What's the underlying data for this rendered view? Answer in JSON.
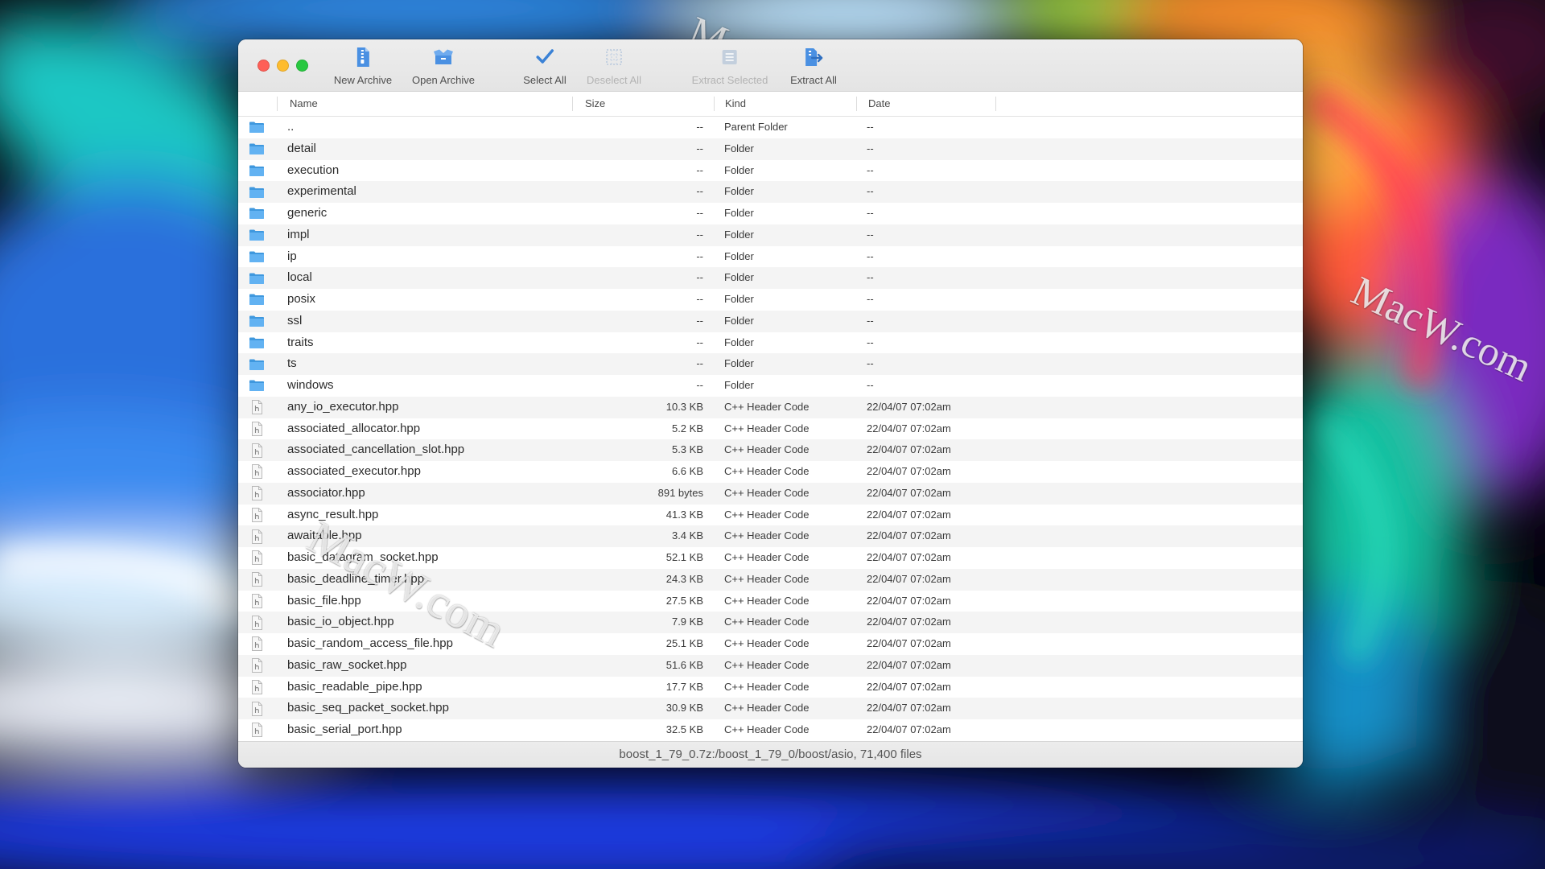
{
  "colors": {
    "accent": "#4a90e2",
    "traffic_close": "#fe5f57",
    "traffic_minimize": "#febc2e",
    "traffic_zoom": "#28c840"
  },
  "toolbar": [
    {
      "label": "New Archive",
      "icon": "new-archive-icon",
      "enabled": true
    },
    {
      "label": "Open Archive",
      "icon": "open-archive-icon",
      "enabled": true
    },
    {
      "label": "Select All",
      "icon": "select-all-icon",
      "enabled": true
    },
    {
      "label": "Deselect All",
      "icon": "deselect-all-icon",
      "enabled": false
    },
    {
      "label": "Extract Selected",
      "icon": "extract-selected-icon",
      "enabled": false
    },
    {
      "label": "Extract All",
      "icon": "extract-all-icon",
      "enabled": true
    }
  ],
  "columns": {
    "name": "Name",
    "size": "Size",
    "kind": "Kind",
    "date": "Date"
  },
  "rows": [
    {
      "name": "..",
      "size": "--",
      "kind": "Parent Folder",
      "date": "--",
      "icon": "folder-icon"
    },
    {
      "name": "detail",
      "size": "--",
      "kind": "Folder",
      "date": "--",
      "icon": "folder-icon"
    },
    {
      "name": "execution",
      "size": "--",
      "kind": "Folder",
      "date": "--",
      "icon": "folder-icon"
    },
    {
      "name": "experimental",
      "size": "--",
      "kind": "Folder",
      "date": "--",
      "icon": "folder-icon"
    },
    {
      "name": "generic",
      "size": "--",
      "kind": "Folder",
      "date": "--",
      "icon": "folder-icon"
    },
    {
      "name": "impl",
      "size": "--",
      "kind": "Folder",
      "date": "--",
      "icon": "folder-icon"
    },
    {
      "name": "ip",
      "size": "--",
      "kind": "Folder",
      "date": "--",
      "icon": "folder-icon"
    },
    {
      "name": "local",
      "size": "--",
      "kind": "Folder",
      "date": "--",
      "icon": "folder-icon"
    },
    {
      "name": "posix",
      "size": "--",
      "kind": "Folder",
      "date": "--",
      "icon": "folder-icon"
    },
    {
      "name": "ssl",
      "size": "--",
      "kind": "Folder",
      "date": "--",
      "icon": "folder-icon"
    },
    {
      "name": "traits",
      "size": "--",
      "kind": "Folder",
      "date": "--",
      "icon": "folder-icon"
    },
    {
      "name": "ts",
      "size": "--",
      "kind": "Folder",
      "date": "--",
      "icon": "folder-icon"
    },
    {
      "name": "windows",
      "size": "--",
      "kind": "Folder",
      "date": "--",
      "icon": "folder-icon"
    },
    {
      "name": "any_io_executor.hpp",
      "size": "10.3 KB",
      "kind": "C++ Header Code",
      "date": "22/04/07 07:02am",
      "icon": "header-file-icon"
    },
    {
      "name": "associated_allocator.hpp",
      "size": "5.2 KB",
      "kind": "C++ Header Code",
      "date": "22/04/07 07:02am",
      "icon": "header-file-icon"
    },
    {
      "name": "associated_cancellation_slot.hpp",
      "size": "5.3 KB",
      "kind": "C++ Header Code",
      "date": "22/04/07 07:02am",
      "icon": "header-file-icon"
    },
    {
      "name": "associated_executor.hpp",
      "size": "6.6 KB",
      "kind": "C++ Header Code",
      "date": "22/04/07 07:02am",
      "icon": "header-file-icon"
    },
    {
      "name": "associator.hpp",
      "size": "891 bytes",
      "kind": "C++ Header Code",
      "date": "22/04/07 07:02am",
      "icon": "header-file-icon"
    },
    {
      "name": "async_result.hpp",
      "size": "41.3 KB",
      "kind": "C++ Header Code",
      "date": "22/04/07 07:02am",
      "icon": "header-file-icon"
    },
    {
      "name": "awaitable.hpp",
      "size": "3.4 KB",
      "kind": "C++ Header Code",
      "date": "22/04/07 07:02am",
      "icon": "header-file-icon"
    },
    {
      "name": "basic_datagram_socket.hpp",
      "size": "52.1 KB",
      "kind": "C++ Header Code",
      "date": "22/04/07 07:02am",
      "icon": "header-file-icon"
    },
    {
      "name": "basic_deadline_timer.hpp",
      "size": "24.3 KB",
      "kind": "C++ Header Code",
      "date": "22/04/07 07:02am",
      "icon": "header-file-icon"
    },
    {
      "name": "basic_file.hpp",
      "size": "27.5 KB",
      "kind": "C++ Header Code",
      "date": "22/04/07 07:02am",
      "icon": "header-file-icon"
    },
    {
      "name": "basic_io_object.hpp",
      "size": "7.9 KB",
      "kind": "C++ Header Code",
      "date": "22/04/07 07:02am",
      "icon": "header-file-icon"
    },
    {
      "name": "basic_random_access_file.hpp",
      "size": "25.1 KB",
      "kind": "C++ Header Code",
      "date": "22/04/07 07:02am",
      "icon": "header-file-icon"
    },
    {
      "name": "basic_raw_socket.hpp",
      "size": "51.6 KB",
      "kind": "C++ Header Code",
      "date": "22/04/07 07:02am",
      "icon": "header-file-icon"
    },
    {
      "name": "basic_readable_pipe.hpp",
      "size": "17.7 KB",
      "kind": "C++ Header Code",
      "date": "22/04/07 07:02am",
      "icon": "header-file-icon"
    },
    {
      "name": "basic_seq_packet_socket.hpp",
      "size": "30.9 KB",
      "kind": "C++ Header Code",
      "date": "22/04/07 07:02am",
      "icon": "header-file-icon"
    },
    {
      "name": "basic_serial_port.hpp",
      "size": "32.5 KB",
      "kind": "C++ Header Code",
      "date": "22/04/07 07:02am",
      "icon": "header-file-icon"
    }
  ],
  "status": "boost_1_79_0.7z:/boost_1_79_0/boost/asio, 71,400 files",
  "watermark": "MacW.com"
}
